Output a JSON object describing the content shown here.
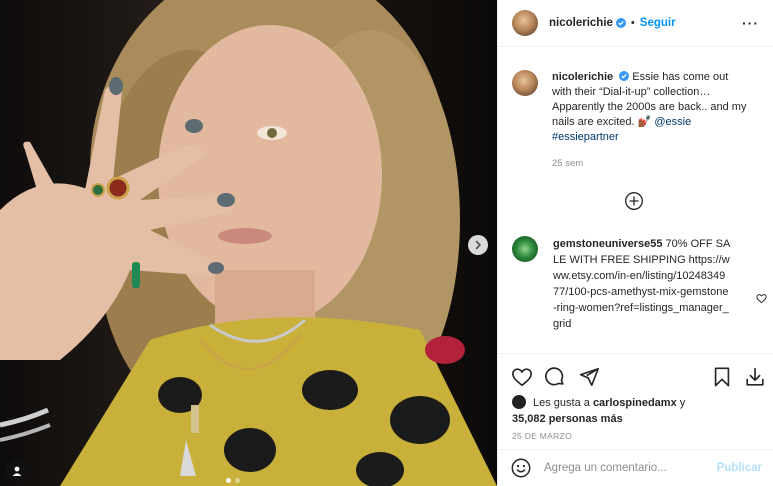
{
  "header": {
    "username": "nicolerichie",
    "separator": "•",
    "follow_label": "Seguir",
    "more_label": "···"
  },
  "caption": {
    "username": "nicolerichie",
    "text": "Essie has come out with their “Dial-it-up” collection… Apparently the 2000s are back.. and my nails are excited. 💅🏾",
    "mention": "@essie",
    "hashtag": "#essiepartner",
    "time": "25 sem"
  },
  "comment": {
    "username": "gemstoneuniverse55",
    "text": "70% OFF SALE WITH FREE SHIPPING https://www.etsy.com/in-en/listing/1024834977/100-pcs-amethyst-mix-gemstone-ring-women?ref=listings_manager_grid"
  },
  "likes": {
    "prefix": "Les gusta a",
    "user": "carlospinedamx",
    "joiner": "y",
    "count": "35,082 personas más"
  },
  "date": "25 DE MARZO",
  "add_comment": {
    "placeholder": "Agrega un comentario...",
    "post_label": "Publicar"
  },
  "icons": {
    "verified": "verified-badge-icon",
    "next": "chevron-right-icon",
    "tag": "user-tag-icon",
    "load_more": "plus-circle-icon",
    "like": "heart-icon",
    "comment": "comment-bubble-icon",
    "share": "paper-plane-icon",
    "save": "bookmark-icon",
    "download": "download-icon",
    "emoji": "emoji-smile-icon"
  },
  "colors": {
    "link": "#00376b",
    "accent": "#0095f6",
    "verified": "#3897f0",
    "muted": "#8e8e8e"
  }
}
